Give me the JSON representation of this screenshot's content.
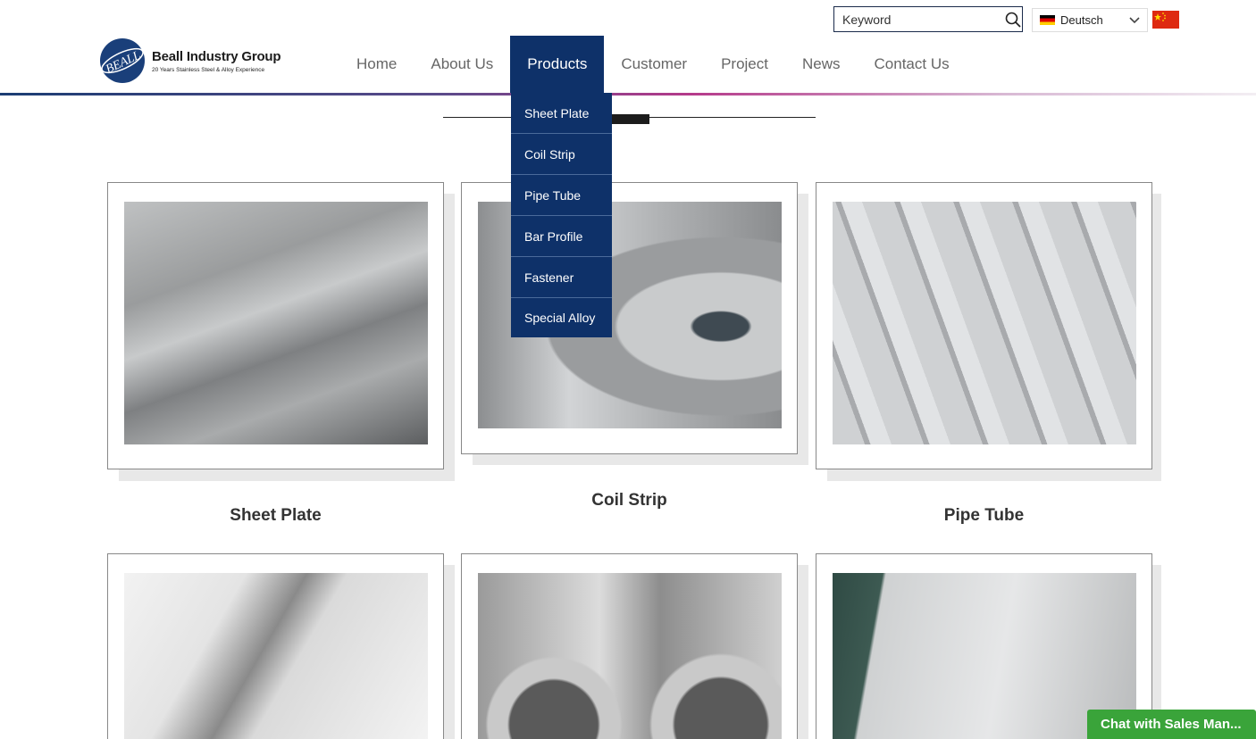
{
  "search": {
    "placeholder": "Keyword"
  },
  "language": {
    "selected": "Deutsch"
  },
  "logo": {
    "mark_text": "BEALL",
    "name": "Beall Industry Group",
    "tagline": "20 Years Stainless Steel & Alloy Experience"
  },
  "nav": {
    "items": [
      {
        "label": "Home"
      },
      {
        "label": "About Us"
      },
      {
        "label": "Products"
      },
      {
        "label": "Customer"
      },
      {
        "label": "Project"
      },
      {
        "label": "News"
      },
      {
        "label": "Contact Us"
      }
    ],
    "active": "Products"
  },
  "dropdown": {
    "items": [
      {
        "label": "Sheet Plate"
      },
      {
        "label": "Coil Strip"
      },
      {
        "label": "Pipe Tube"
      },
      {
        "label": "Bar Profile"
      },
      {
        "label": "Fastener"
      },
      {
        "label": "Special Alloy"
      }
    ]
  },
  "products": [
    {
      "title": "Sheet Plate"
    },
    {
      "title": "Coil Strip"
    },
    {
      "title": "Pipe Tube"
    }
  ],
  "chat": {
    "label": "Chat with Sales Man..."
  },
  "colors": {
    "nav_active": "#0e3169",
    "chat": "#3aa43a"
  }
}
